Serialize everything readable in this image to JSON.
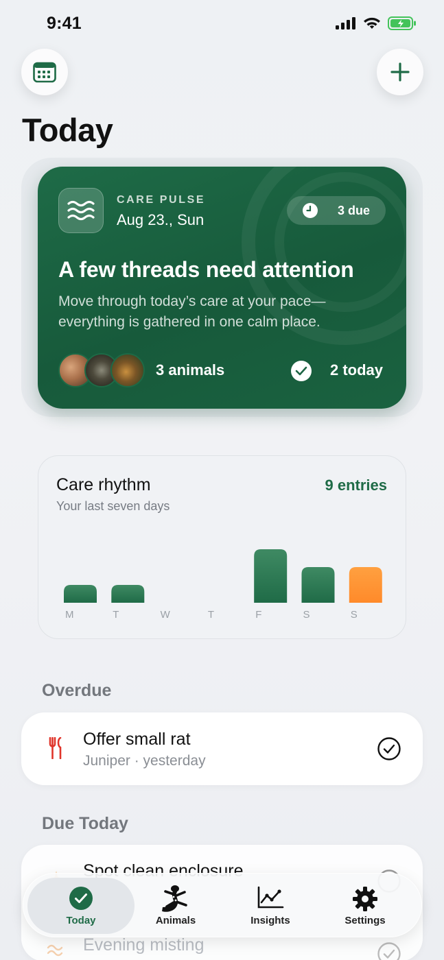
{
  "status_bar": {
    "time": "9:41"
  },
  "page": {
    "title": "Today"
  },
  "pulse": {
    "kicker": "CARE PULSE",
    "date": "Aug 23., Sun",
    "due_label": "3 due",
    "headline": "A few threads need attention",
    "subtext": "Move through today’s care at your pace—everything is gathered in one calm place.",
    "animals_label": "3 animals",
    "today_label": "2 today"
  },
  "rhythm": {
    "title": "Care rhythm",
    "subtitle": "Your last seven days",
    "entries_label": "9 entries"
  },
  "chart_data": {
    "type": "bar",
    "categories": [
      "M",
      "T",
      "W",
      "T",
      "F",
      "S",
      "S"
    ],
    "values": [
      1,
      1,
      0,
      0,
      3,
      2,
      2
    ],
    "highlight_index": 6,
    "colors": {
      "bar": "#1f6b47",
      "highlight": "#ff8a2a"
    }
  },
  "sections": {
    "overdue": "Overdue",
    "due_today": "Due Today"
  },
  "tasks": {
    "overdue": [
      {
        "title": "Offer small rat",
        "meta": "Juniper · yesterday",
        "icon": "fork-knife-icon"
      }
    ],
    "due_today": [
      {
        "title": "Spot clean enclosure",
        "icon": "sparkle-icon"
      },
      {
        "title": "Evening misting",
        "icon": "mist-icon"
      }
    ]
  },
  "tabs": [
    {
      "label": "Today",
      "icon": "checkmark-circle-icon",
      "active": true
    },
    {
      "label": "Animals",
      "icon": "lizard-icon"
    },
    {
      "label": "Insights",
      "icon": "line-chart-icon"
    },
    {
      "label": "Settings",
      "icon": "gear-icon"
    }
  ],
  "colors": {
    "accent": "#1f6b47",
    "card_green": "#1a6240",
    "overdue_red": "#e0352b",
    "highlight_orange": "#ff8a2a"
  }
}
